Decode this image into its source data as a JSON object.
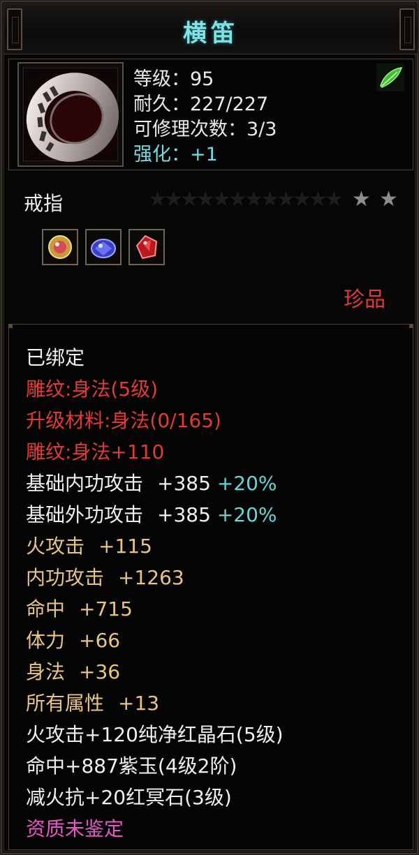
{
  "title": "横笛",
  "header": {
    "level": "等级：95",
    "durability": "耐久：227/227",
    "repair": "可修理次数：3/3",
    "enhance": "强化：+1"
  },
  "item_type": "戒指",
  "stars": {
    "total": 14,
    "lit": 2
  },
  "gems": [
    "yellow-gem-icon",
    "blue-gem-icon",
    "red-gem-icon"
  ],
  "rarity": "珍品",
  "details": {
    "bound": "已绑定",
    "engrave": "雕纹:身法(5级)",
    "upgrade_material": "升级材料:身法(0/165)",
    "engrave_bonus": "雕纹:身法+110",
    "inner_attack": {
      "label": "基础内功攻击",
      "value": "+385",
      "pct": "+20%"
    },
    "outer_attack": {
      "label": "基础外功攻击",
      "value": "+385",
      "pct": "+20%"
    },
    "fire_attack": {
      "label": "火攻击",
      "value": "+115"
    },
    "inner_power": {
      "label": "内功攻击",
      "value": "+1263"
    },
    "hit": {
      "label": "命中",
      "value": "+715"
    },
    "stamina": {
      "label": "体力",
      "value": "+66"
    },
    "agility": {
      "label": "身法",
      "value": "+36"
    },
    "all_attr": {
      "label": "所有属性",
      "value": "+13"
    },
    "gem_fire": "火攻击+120纯净红晶石(5级)",
    "gem_hit": "命中+887紫玉(4级2阶)",
    "gem_resist": "减火抗+20红冥石(3级)",
    "aptitude": "资质未鉴定"
  },
  "colors": {
    "title": "#7fe3e6",
    "enhance": "#79d9e0",
    "red": "#e23b36",
    "orange": "#e9c584",
    "percent": "#62d8d8",
    "aptitude": "#e659c4"
  }
}
